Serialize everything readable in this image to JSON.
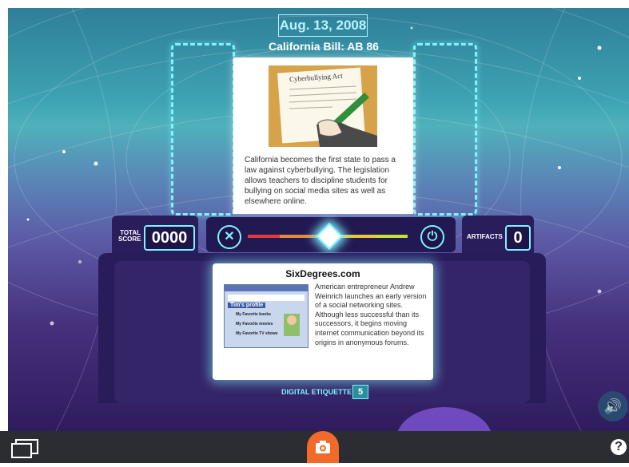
{
  "timeline": {
    "date": "Aug. 13, 2008",
    "title": "California Bill: AB 86",
    "image_caption": "Cyberbullying Act",
    "description": "California becomes the first state to pass a law against cyberbullying. The legislation allows teachers to discipline students for bullying on social media sites as well as elsewhere online."
  },
  "scoreboard": {
    "total_score_label_line1": "TOTAL",
    "total_score_label_line2": "SCORE",
    "total_score_value": "0000",
    "artifacts_label": "ARTIFACTS",
    "artifacts_value": "0"
  },
  "controls": {
    "reject_icon": "close-x-icon",
    "confirm_icon": "power-icon",
    "meter_colors": [
      "#e23b3b",
      "#e6893a",
      "#e6c93a",
      "#c7e03a"
    ]
  },
  "current_card": {
    "title": "SixDegrees.com",
    "description": "American entrepreneur Andrew Weinrich launches an early version of a social networking sites. Although less successful than its successors, it begins moving internet communication beyond its origins in anonymous forums.",
    "thumbnail_profile_title": "Tim's profile",
    "thumbnail_lines": [
      "My Favorite books",
      "My Favorite movies",
      "My Favorite TV shows"
    ]
  },
  "category": {
    "label": "DIGITAL ETIQUETTE",
    "count": "5"
  },
  "toolbar": {
    "gallery_icon": "gallery-icon",
    "camera_icon": "camera-icon",
    "help_label": "?",
    "sound_icon": "speaker-icon"
  },
  "colors": {
    "accent": "#7ff3ff",
    "camera": "#f16a2a",
    "bar": "#2c2d33"
  }
}
